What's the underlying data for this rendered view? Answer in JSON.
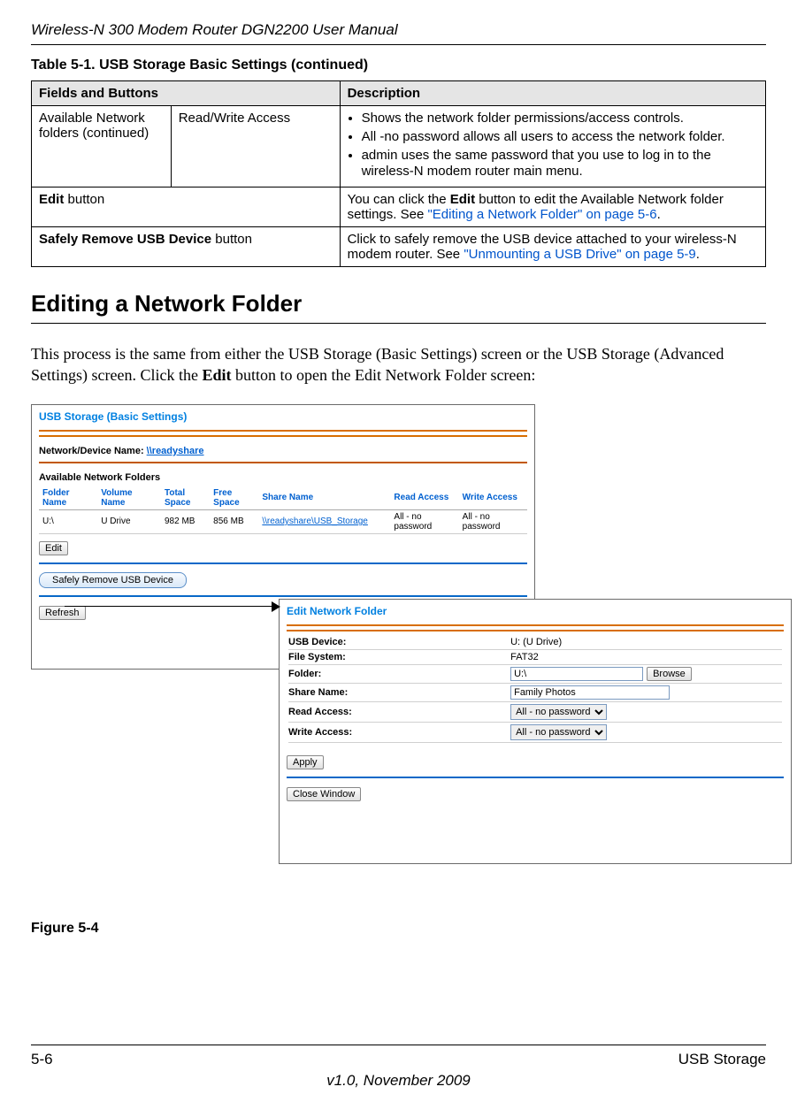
{
  "doc_title": "Wireless-N 300 Modem Router DGN2200 User Manual",
  "table_caption": "Table 5-1.  USB Storage Basic Settings  (continued)",
  "table_head": {
    "col1": "Fields and Buttons",
    "col2": "Description"
  },
  "rows": {
    "r1c1": "Available Network folders (continued)",
    "r1c2": "Read/Write Access",
    "r1_bullets": {
      "b1": "Shows the network folder permissions/access controls.",
      "b2": "All -no password allows all users to access the network folder.",
      "b3": "admin uses the same password that you use to log in to the wireless-N modem router main menu."
    },
    "r2_label_bold": "Edit",
    "r2_label_rest": " button",
    "r2_desc_pre": "You can click the ",
    "r2_desc_bold": "Edit",
    "r2_desc_post": " button to edit the Available Network folder settings. See ",
    "r2_link": "\"Editing a Network Folder\" on page 5-6",
    "r2_end": ".",
    "r3_label_bold": "Safely Remove USB Device",
    "r3_label_rest": " button",
    "r3_desc_pre": "Click to safely remove the USB device attached to your wireless-N modem router. See ",
    "r3_link": "\"Unmounting a USB Drive\" on page 5-9",
    "r3_end": "."
  },
  "section_heading": "Editing a Network Folder",
  "body_para_pre": "This process is the same from either the USB Storage (Basic Settings) screen or the USB Storage (Advanced Settings) screen. Click the ",
  "body_para_bold": "Edit",
  "body_para_post": " button to open the Edit Network Folder screen:",
  "basic_win": {
    "title": "USB Storage (Basic Settings)",
    "net_label": "Network/Device Name:",
    "net_link": "\\\\readyshare",
    "avail_label": "Available Network Folders",
    "cols": {
      "c1": "Folder Name",
      "c2": "Volume Name",
      "c3": "Total Space",
      "c4": "Free Space",
      "c5": "Share Name",
      "c6": "Read Access",
      "c7": "Write Access"
    },
    "row": {
      "v1": "U:\\",
      "v2": "U Drive",
      "v3": "982 MB",
      "v4": "856 MB",
      "v5": "\\\\readyshare\\USB_Storage",
      "v6": "All - no password",
      "v7": "All - no password"
    },
    "btn_edit": "Edit",
    "btn_safely": "Safely Remove USB Device",
    "btn_refresh": "Refresh"
  },
  "edit_win": {
    "title": "Edit Network Folder",
    "usb_device_lbl": "USB Device:",
    "usb_device_val": "U: (U Drive)",
    "filesys_lbl": "File System:",
    "filesys_val": "FAT32",
    "folder_lbl": "Folder:",
    "folder_val": "U:\\",
    "browse_btn": "Browse",
    "share_lbl": "Share Name:",
    "share_val": "Family Photos",
    "read_lbl": "Read Access:",
    "read_val": "All - no password",
    "write_lbl": "Write Access:",
    "write_val": "All - no password",
    "apply_btn": "Apply",
    "close_btn": "Close Window"
  },
  "figure_label": "Figure 5-4",
  "footer": {
    "page_num": "5-6",
    "section_name": "USB Storage",
    "version": "v1.0, November 2009"
  }
}
